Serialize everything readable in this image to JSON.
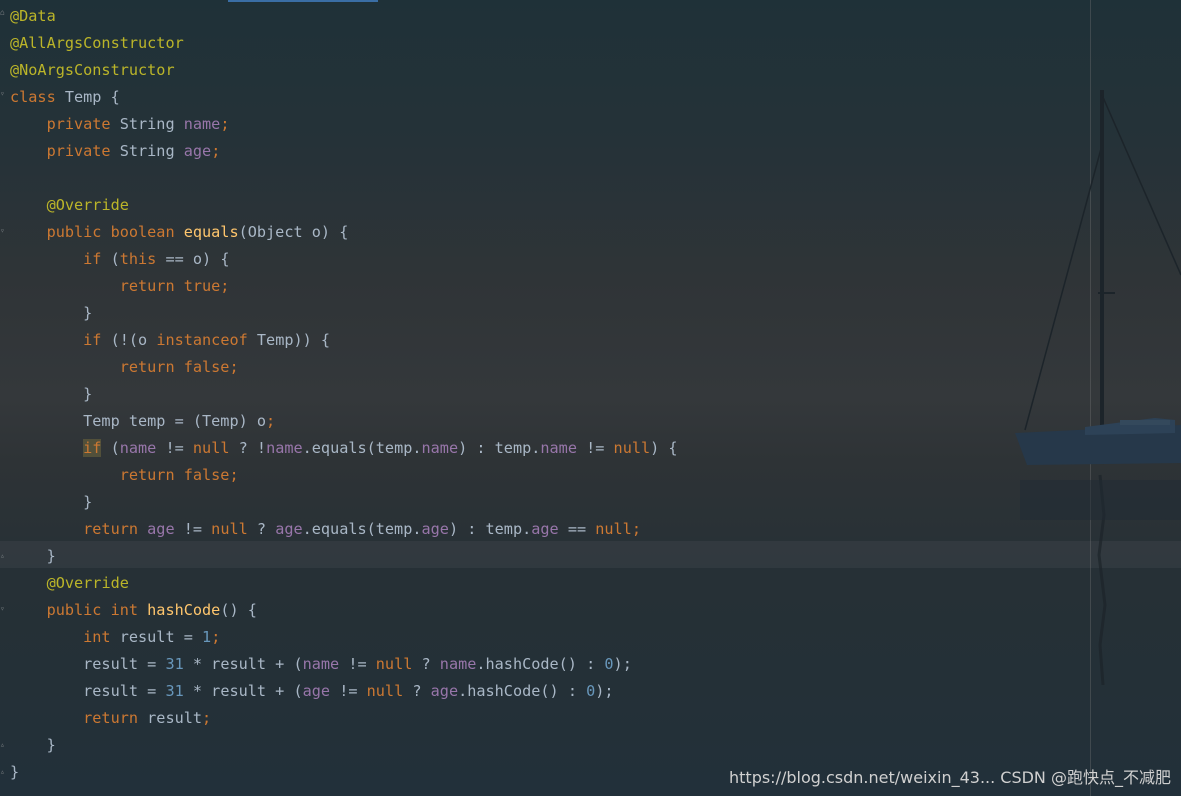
{
  "colors": {
    "annotation": "#bbb529",
    "keyword": "#cc7832",
    "field": "#9876aa",
    "method": "#ffc66d",
    "number": "#6897bb",
    "text": "#a9b7c6"
  },
  "code": {
    "lines": [
      [
        {
          "t": "@Data",
          "c": "ann"
        }
      ],
      [
        {
          "t": "@AllArgsConstructor",
          "c": "ann"
        }
      ],
      [
        {
          "t": "@NoArgsConstructor",
          "c": "ann"
        }
      ],
      [
        {
          "t": "class ",
          "c": "kw"
        },
        {
          "t": "Temp {",
          "c": "txt"
        }
      ],
      [
        {
          "t": "    private ",
          "c": "kw"
        },
        {
          "t": "String ",
          "c": "txt"
        },
        {
          "t": "name",
          "c": "fld"
        },
        {
          "t": ";",
          "c": "kw"
        }
      ],
      [
        {
          "t": "    private ",
          "c": "kw"
        },
        {
          "t": "String ",
          "c": "txt"
        },
        {
          "t": "age",
          "c": "fld"
        },
        {
          "t": ";",
          "c": "kw"
        }
      ],
      [
        {
          "t": "",
          "c": "txt"
        }
      ],
      [
        {
          "t": "    ",
          "c": "txt"
        },
        {
          "t": "@Override",
          "c": "ann"
        }
      ],
      [
        {
          "t": "    public boolean ",
          "c": "kw"
        },
        {
          "t": "equals",
          "c": "fn"
        },
        {
          "t": "(Object o) {",
          "c": "txt"
        }
      ],
      [
        {
          "t": "        if ",
          "c": "kw"
        },
        {
          "t": "(",
          "c": "txt"
        },
        {
          "t": "this ",
          "c": "kw"
        },
        {
          "t": "== o) {",
          "c": "txt"
        }
      ],
      [
        {
          "t": "            return true;",
          "c": "kw"
        }
      ],
      [
        {
          "t": "        }",
          "c": "txt"
        }
      ],
      [
        {
          "t": "        if ",
          "c": "kw"
        },
        {
          "t": "(!(o ",
          "c": "txt"
        },
        {
          "t": "instanceof ",
          "c": "kw"
        },
        {
          "t": "Temp)) {",
          "c": "txt"
        }
      ],
      [
        {
          "t": "            return false;",
          "c": "kw"
        }
      ],
      [
        {
          "t": "        }",
          "c": "txt"
        }
      ],
      [
        {
          "t": "        Temp temp = (Temp) o",
          "c": "txt"
        },
        {
          "t": ";",
          "c": "kw"
        }
      ],
      [
        {
          "t": "        ",
          "c": "txt"
        },
        {
          "t": "if",
          "c": "kw hl-if"
        },
        {
          "t": " (",
          "c": "txt"
        },
        {
          "t": "name ",
          "c": "fld"
        },
        {
          "t": "!= ",
          "c": "txt"
        },
        {
          "t": "null ",
          "c": "kw"
        },
        {
          "t": "? !",
          "c": "txt"
        },
        {
          "t": "name",
          "c": "fld"
        },
        {
          "t": ".equals(temp.",
          "c": "txt"
        },
        {
          "t": "name",
          "c": "fld"
        },
        {
          "t": ") : temp.",
          "c": "txt"
        },
        {
          "t": "name ",
          "c": "fld"
        },
        {
          "t": "!= ",
          "c": "txt"
        },
        {
          "t": "null",
          "c": "kw"
        },
        {
          "t": ") {",
          "c": "txt"
        }
      ],
      [
        {
          "t": "            return false;",
          "c": "kw"
        }
      ],
      [
        {
          "t": "        }",
          "c": "txt"
        }
      ],
      [
        {
          "t": "        return ",
          "c": "kw"
        },
        {
          "t": "age ",
          "c": "fld"
        },
        {
          "t": "!= ",
          "c": "txt"
        },
        {
          "t": "null ",
          "c": "kw"
        },
        {
          "t": "? ",
          "c": "txt"
        },
        {
          "t": "age",
          "c": "fld"
        },
        {
          "t": ".equals(temp.",
          "c": "txt"
        },
        {
          "t": "age",
          "c": "fld"
        },
        {
          "t": ") : temp.",
          "c": "txt"
        },
        {
          "t": "age ",
          "c": "fld"
        },
        {
          "t": "== ",
          "c": "txt"
        },
        {
          "t": "null;",
          "c": "kw"
        }
      ],
      [
        {
          "t": "    }",
          "c": "txt"
        }
      ],
      [
        {
          "t": "    ",
          "c": "txt"
        },
        {
          "t": "@Override",
          "c": "ann"
        }
      ],
      [
        {
          "t": "    public int ",
          "c": "kw"
        },
        {
          "t": "hashCode",
          "c": "fn"
        },
        {
          "t": "() {",
          "c": "txt"
        }
      ],
      [
        {
          "t": "        int ",
          "c": "kw"
        },
        {
          "t": "result = ",
          "c": "txt"
        },
        {
          "t": "1",
          "c": "num"
        },
        {
          "t": ";",
          "c": "kw"
        }
      ],
      [
        {
          "t": "        result = ",
          "c": "txt"
        },
        {
          "t": "31 ",
          "c": "num"
        },
        {
          "t": "* result + (",
          "c": "txt"
        },
        {
          "t": "name ",
          "c": "fld"
        },
        {
          "t": "!= ",
          "c": "txt"
        },
        {
          "t": "null ",
          "c": "kw"
        },
        {
          "t": "? ",
          "c": "txt"
        },
        {
          "t": "name",
          "c": "fld"
        },
        {
          "t": ".hashCode() : ",
          "c": "txt"
        },
        {
          "t": "0",
          "c": "num"
        },
        {
          "t": ");",
          "c": "txt"
        }
      ],
      [
        {
          "t": "        result = ",
          "c": "txt"
        },
        {
          "t": "31 ",
          "c": "num"
        },
        {
          "t": "* result + (",
          "c": "txt"
        },
        {
          "t": "age ",
          "c": "fld"
        },
        {
          "t": "!= ",
          "c": "txt"
        },
        {
          "t": "null ",
          "c": "kw"
        },
        {
          "t": "? ",
          "c": "txt"
        },
        {
          "t": "age",
          "c": "fld"
        },
        {
          "t": ".hashCode() : ",
          "c": "txt"
        },
        {
          "t": "0",
          "c": "num"
        },
        {
          "t": ");",
          "c": "txt"
        }
      ],
      [
        {
          "t": "        return ",
          "c": "kw"
        },
        {
          "t": "result",
          "c": "txt"
        },
        {
          "t": ";",
          "c": "kw"
        }
      ],
      [
        {
          "t": "    }",
          "c": "txt"
        }
      ],
      [
        {
          "t": "}",
          "c": "txt"
        }
      ]
    ]
  },
  "watermark": "https://blog.csdn.net/weixin_43...  CSDN @跑快点_不减肥"
}
